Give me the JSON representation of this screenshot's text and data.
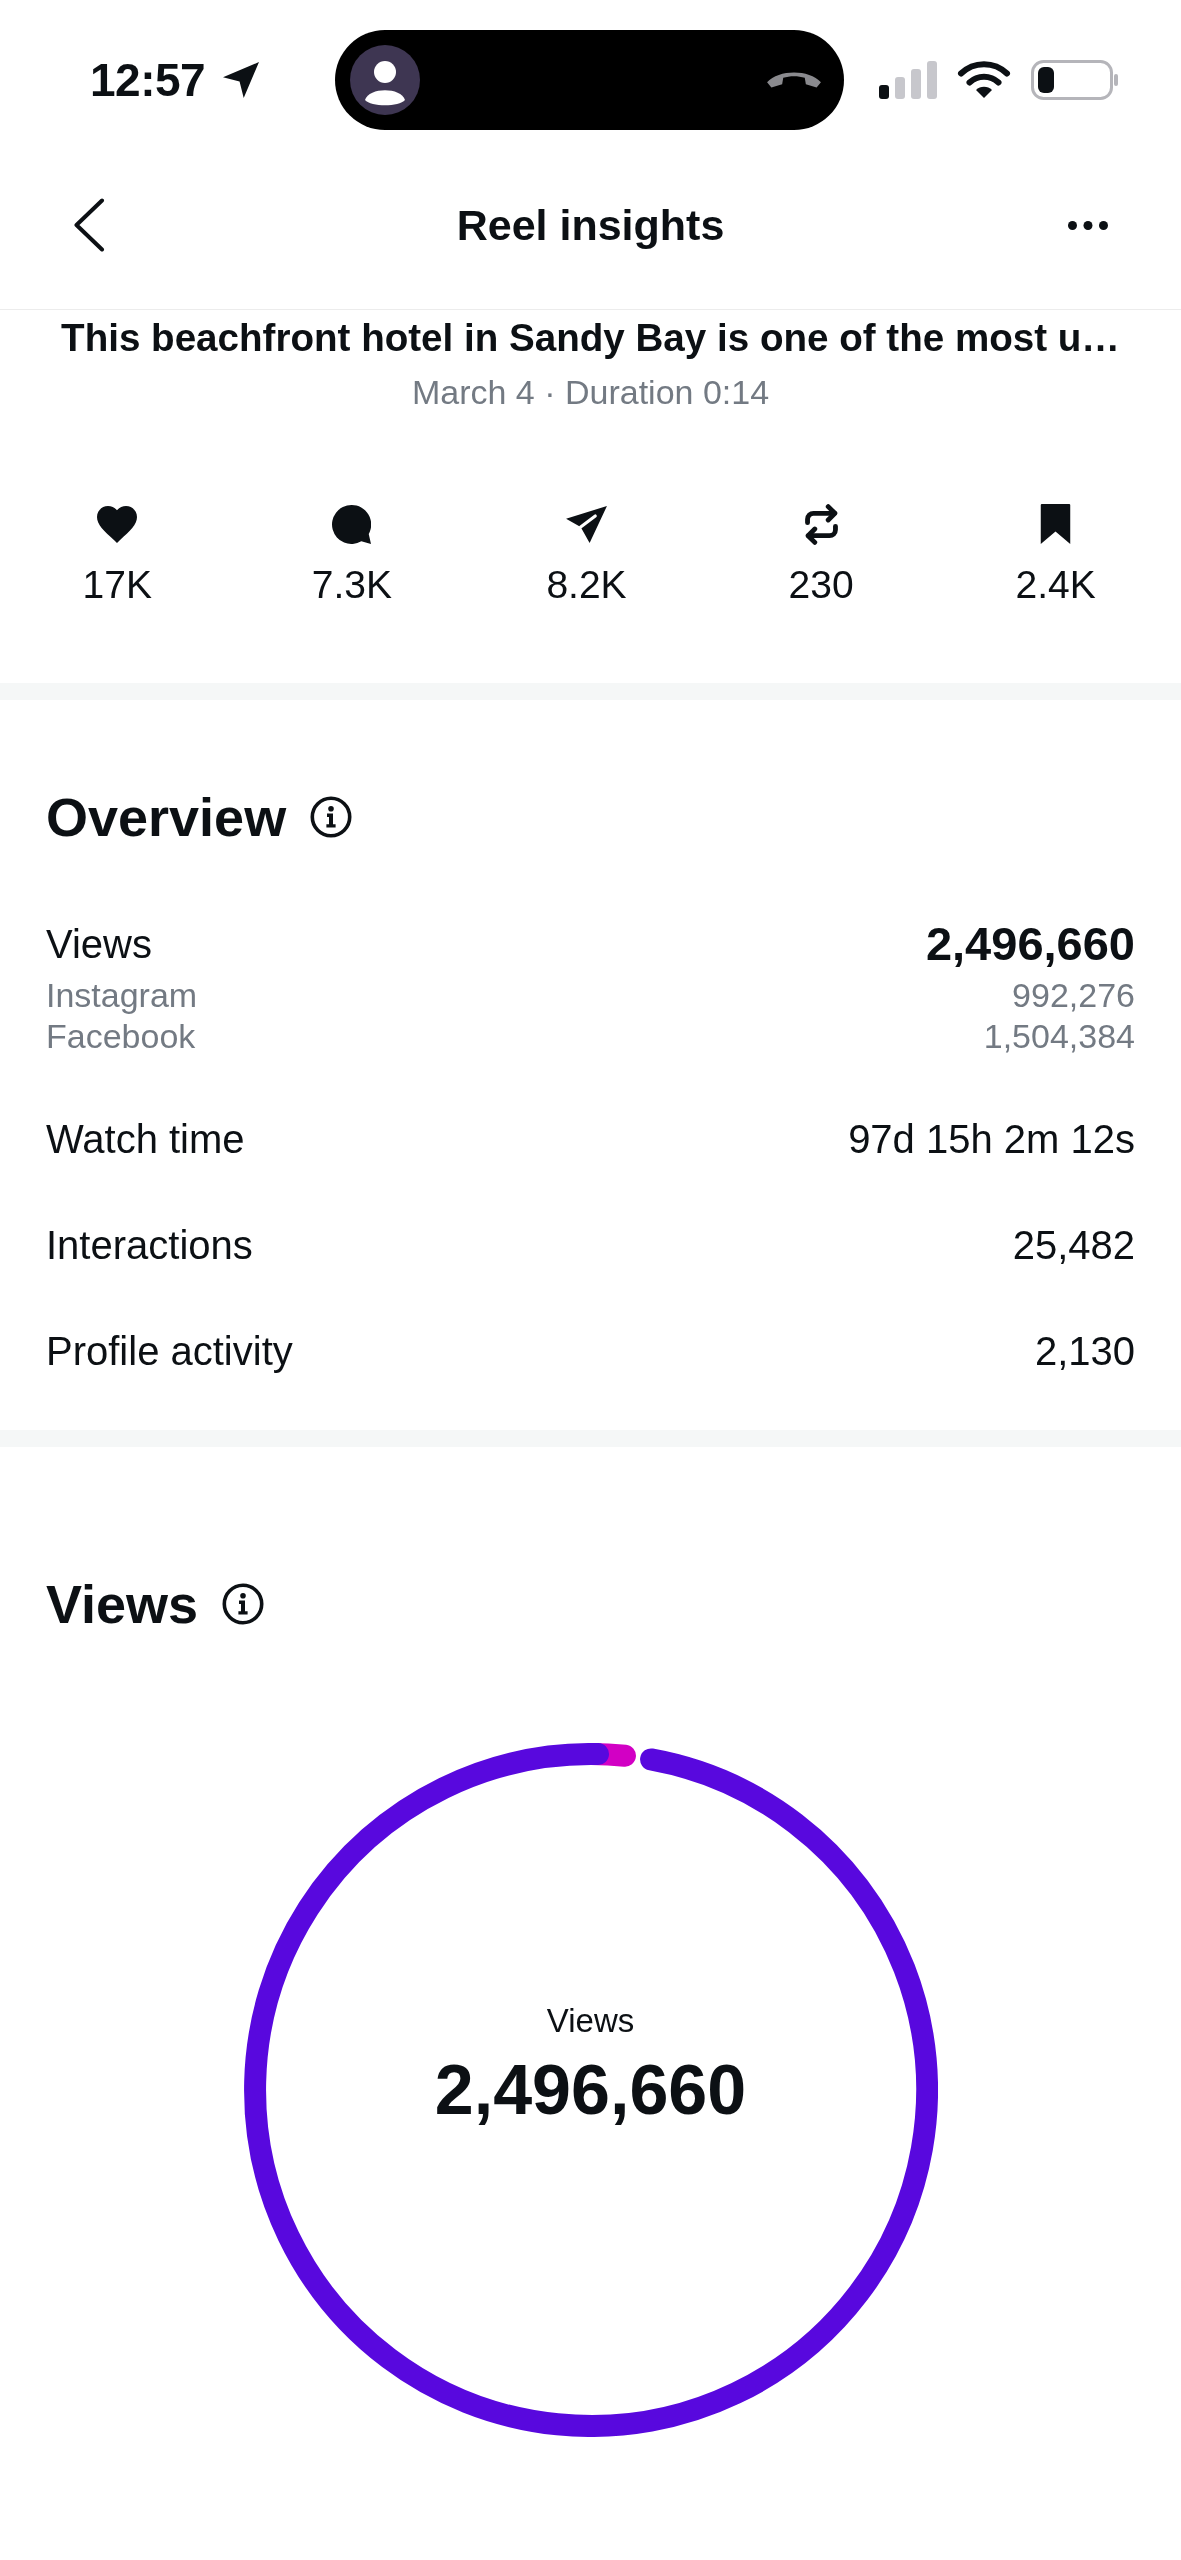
{
  "status_bar": {
    "time": "12:57"
  },
  "header": {
    "title": "Reel insights"
  },
  "post": {
    "title": "This beachfront hotel in Sandy Bay is one of the most u…",
    "meta": "March 4 · Duration 0:14"
  },
  "engagement": [
    {
      "kind": "likes",
      "value": "17K"
    },
    {
      "kind": "comments",
      "value": "7.3K"
    },
    {
      "kind": "shares",
      "value": "8.2K"
    },
    {
      "kind": "reposts",
      "value": "230"
    },
    {
      "kind": "saves",
      "value": "2.4K"
    }
  ],
  "overview": {
    "title": "Overview",
    "rows": [
      {
        "label": "Views",
        "value": "2,496,660",
        "breakdown": [
          {
            "label": "Instagram",
            "value": "992,276"
          },
          {
            "label": "Facebook",
            "value": "1,504,384"
          }
        ]
      },
      {
        "label": "Watch time",
        "value": "97d 15h 2m 12s"
      },
      {
        "label": "Interactions",
        "value": "25,482"
      },
      {
        "label": "Profile activity",
        "value": "2,130"
      }
    ]
  },
  "views": {
    "title": "Views",
    "center_label": "Views",
    "center_value": "2,496,660"
  }
}
